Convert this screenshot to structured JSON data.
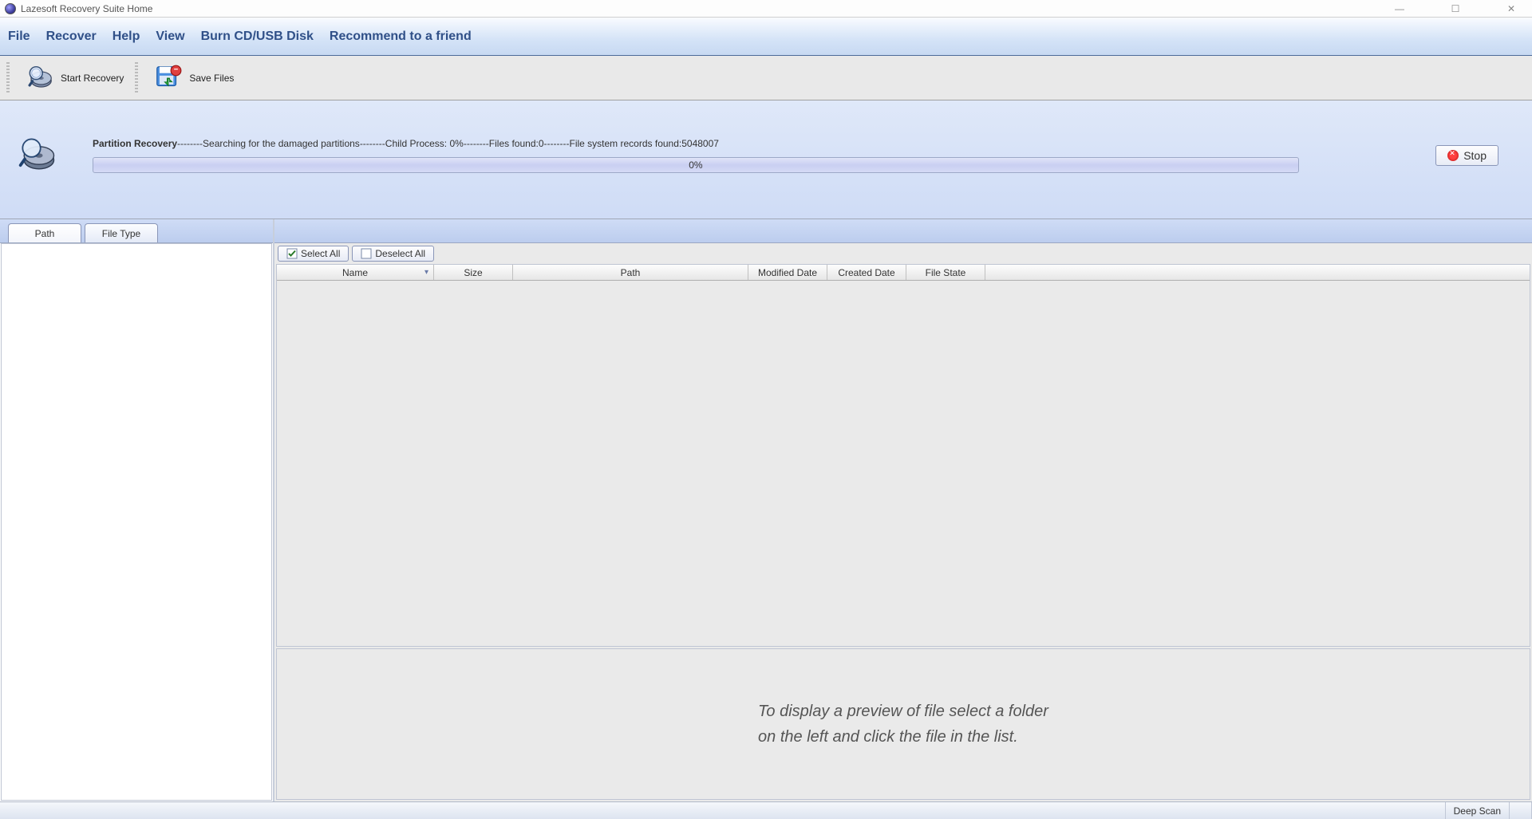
{
  "window": {
    "title": "Lazesoft Recovery Suite Home"
  },
  "menu": {
    "file": "File",
    "recover": "Recover",
    "help": "Help",
    "view": "View",
    "burn": "Burn CD/USB Disk",
    "recommend": "Recommend to a friend"
  },
  "toolbar": {
    "start_recovery": "Start Recovery",
    "save_files": "Save Files"
  },
  "progress": {
    "title": "Partition Recovery",
    "sep": "--------",
    "searching": "Searching for the damaged partitions",
    "child_label": "Child Process: ",
    "child_value": "0%",
    "files_label": "Files found:",
    "files_value": "0",
    "records_label": "File system records found:",
    "records_value": "5048007",
    "bar_text": "0%",
    "stop": "Stop"
  },
  "tabs": {
    "path": "Path",
    "filetype": "File Type"
  },
  "selection": {
    "select_all": "Select All",
    "deselect_all": "Deselect All"
  },
  "columns": {
    "name": "Name",
    "size": "Size",
    "path": "Path",
    "modified": "Modified Date",
    "created": "Created Date",
    "state": "File State"
  },
  "preview": {
    "line1": "To display a preview of file select a folder",
    "line2": "on the left and click the file in the list."
  },
  "statusbar": {
    "mode": "Deep Scan"
  }
}
